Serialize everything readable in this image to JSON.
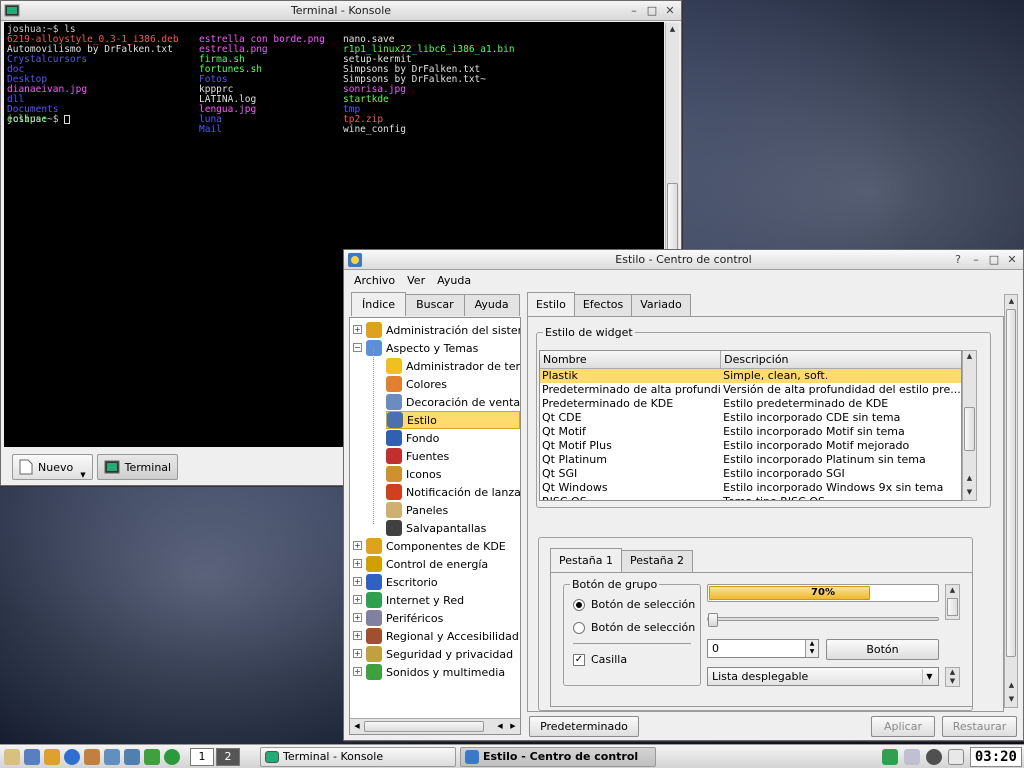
{
  "colors": {
    "selection": "#fddb6c",
    "term_bg": "#000000",
    "term_red": "#ff5555",
    "term_blue": "#5555ff",
    "term_cyan": "#44d7d7",
    "term_green": "#55ff55",
    "term_mag": "#ff55ff"
  },
  "terminal": {
    "title": "Terminal - Konsole",
    "prompt_ls": "joshua:~$ ls",
    "prompt_end": "joshua:~$ ",
    "col1": [
      {
        "t": "6219-alloystyle_0.3-1_i386.deb",
        "c": "red"
      },
      {
        "t": "Automovilismo by DrFalken.txt",
        "c": "white"
      },
      {
        "t": "Crystalcursors",
        "c": "blue"
      },
      {
        "t": "doc",
        "c": "blue"
      },
      {
        "t": "Desktop",
        "c": "blue"
      },
      {
        "t": "dianaeivan.jpg",
        "c": "mag"
      },
      {
        "t": "dll",
        "c": "blue"
      },
      {
        "t": "Documents",
        "c": "blue"
      },
      {
        "t": "eclipse",
        "c": "green"
      }
    ],
    "col2": [
      {
        "t": "estrella con borde.png",
        "c": "mag"
      },
      {
        "t": "estrella.png",
        "c": "mag"
      },
      {
        "t": "firma.sh",
        "c": "green"
      },
      {
        "t": "fortunes.sh",
        "c": "green"
      },
      {
        "t": "Fotos",
        "c": "blue"
      },
      {
        "t": "kppprc",
        "c": "white"
      },
      {
        "t": "LATINA.log",
        "c": "white"
      },
      {
        "t": "lengua.jpg",
        "c": "mag"
      },
      {
        "t": "luna",
        "c": "blue"
      },
      {
        "t": "Mail",
        "c": "blue"
      }
    ],
    "col3": [
      {
        "t": "nano.save",
        "c": "white"
      },
      {
        "t": "r1p1_linux22_libc6_i386_a1.bin",
        "c": "green"
      },
      {
        "t": "setup-kermit",
        "c": "white"
      },
      {
        "t": "Simpsons by DrFalken.txt",
        "c": "white"
      },
      {
        "t": "Simpsons by DrFalken.txt~",
        "c": "white"
      },
      {
        "t": "sonrisa.jpg",
        "c": "mag"
      },
      {
        "t": "startkde",
        "c": "green"
      },
      {
        "t": "tmp",
        "c": "blue"
      },
      {
        "t": "tp2.zip",
        "c": "red"
      },
      {
        "t": "wine_config",
        "c": "white"
      }
    ],
    "tab_new": "Nuevo",
    "tab_terminal": "Terminal"
  },
  "kcc": {
    "title": "Estilo - Centro de control",
    "menu": [
      "Archivo",
      "Ver",
      "Ayuda"
    ],
    "left_tabs": [
      "Índice",
      "Buscar",
      "Ayuda"
    ],
    "tree": [
      {
        "label": "Administración del sistema",
        "level": 0,
        "exp": "+",
        "color": "#e0a020"
      },
      {
        "label": "Aspecto y Temas",
        "level": 0,
        "exp": "-",
        "color": "#5b8fd6"
      },
      {
        "label": "Administrador de temas",
        "level": 1,
        "color": "#f0c020"
      },
      {
        "label": "Colores",
        "level": 1,
        "color": "#e08030"
      },
      {
        "label": "Decoración de ventanas",
        "level": 1,
        "color": "#6a8cc0"
      },
      {
        "label": "Estilo",
        "level": 1,
        "color": "#4a70b0",
        "sel": true
      },
      {
        "label": "Fondo",
        "level": 1,
        "color": "#3060b0"
      },
      {
        "label": "Fuentes",
        "level": 1,
        "color": "#c03030"
      },
      {
        "label": "Iconos",
        "level": 1,
        "color": "#d09030"
      },
      {
        "label": "Notificación de lanzamiento",
        "level": 1,
        "color": "#d04020"
      },
      {
        "label": "Paneles",
        "level": 1,
        "color": "#d0b070"
      },
      {
        "label": "Salvapantallas",
        "level": 1,
        "color": "#404040"
      },
      {
        "label": "Componentes de KDE",
        "level": 0,
        "exp": "+",
        "color": "#e0a020"
      },
      {
        "label": "Control de energía",
        "level": 0,
        "exp": "+",
        "color": "#d0a000"
      },
      {
        "label": "Escritorio",
        "level": 0,
        "exp": "+",
        "color": "#3060c0"
      },
      {
        "label": "Internet y Red",
        "level": 0,
        "exp": "+",
        "color": "#30a050"
      },
      {
        "label": "Periféricos",
        "level": 0,
        "exp": "+",
        "color": "#8080a0"
      },
      {
        "label": "Regional y Accesibilidad",
        "level": 0,
        "exp": "+",
        "color": "#a05030"
      },
      {
        "label": "Seguridad y privacidad",
        "level": 0,
        "exp": "+",
        "color": "#c0a040"
      },
      {
        "label": "Sonidos y multimedia",
        "level": 0,
        "exp": "+",
        "color": "#40a040"
      }
    ],
    "tabs": [
      "Estilo",
      "Efectos",
      "Variado"
    ],
    "widget_group": "Estilo de widget",
    "col_name": "Nombre",
    "col_desc": "Descripción",
    "styles": [
      {
        "n": "Plastik",
        "d": "Simple, clean, soft.",
        "sel": true
      },
      {
        "n": "Predeterminado de alta profundidad",
        "d": "Versión de alta profundidad del estilo pre..."
      },
      {
        "n": "Predeterminado de KDE",
        "d": "Estilo predeterminado de KDE"
      },
      {
        "n": "Qt CDE",
        "d": "Estilo incorporado CDE sin tema"
      },
      {
        "n": "Qt Motif",
        "d": "Estilo incorporado Motif sin tema"
      },
      {
        "n": "Qt Motif Plus",
        "d": "Estilo incorporado Motif mejorado"
      },
      {
        "n": "Qt Platinum",
        "d": "Estilo incorporado Platinum sin tema"
      },
      {
        "n": "Qt SGI",
        "d": "Estilo incorporado SGI"
      },
      {
        "n": "Qt Windows",
        "d": "Estilo incorporado Windows 9x sin tema"
      },
      {
        "n": "RISC OS",
        "d": "Tema tipo RISC OS"
      }
    ],
    "preview": {
      "tabs": [
        "Pestaña 1",
        "Pestaña 2"
      ],
      "group": "Botón de grupo",
      "radio1": "Botón de selección",
      "radio2": "Botón de selección",
      "checkbox": "Casilla",
      "progress_text": "70%",
      "progress": 0.7,
      "spin_value": "0",
      "button": "Botón",
      "combo": "Lista desplegable"
    },
    "btn_default": "Predeterminado",
    "btn_apply": "Aplicar",
    "btn_reset": "Restaurar"
  },
  "taskbar": {
    "pages": [
      "1",
      "2"
    ],
    "tasks": [
      "Terminal - Konsole",
      "Estilo - Centro de control"
    ],
    "clock": "03:20"
  }
}
